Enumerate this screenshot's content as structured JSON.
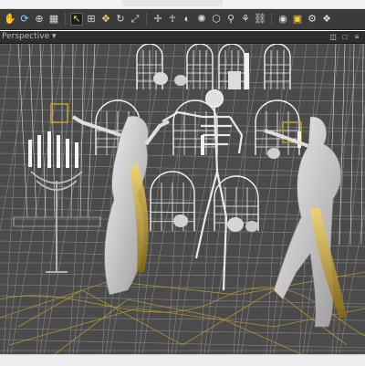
{
  "toolbar": {
    "tools": [
      {
        "icon": "hand-icon",
        "glyph": "✋",
        "color": "#d9d9d9"
      },
      {
        "icon": "rotate-view-icon",
        "glyph": "⟳",
        "color": "#8fd4ff"
      },
      {
        "icon": "zoom-icon",
        "glyph": "⊕",
        "color": "#d9d9d9"
      },
      {
        "icon": "grid-snap-icon",
        "glyph": "▦",
        "color": "#d9d9d9"
      },
      {
        "icon": "select-arrow-icon",
        "glyph": "↖",
        "color": "#ffc63a"
      },
      {
        "icon": "node-select-icon",
        "glyph": "⊞",
        "color": "#d9d9d9"
      },
      {
        "icon": "translate-icon",
        "glyph": "✥",
        "color": "#f0d060"
      },
      {
        "icon": "rotate-icon",
        "glyph": "↻",
        "color": "#d9d9d9"
      },
      {
        "icon": "scale-icon",
        "glyph": "⤢",
        "color": "#d9d9d9"
      },
      {
        "icon": "universal-icon",
        "glyph": "✛",
        "color": "#d9d9d9"
      },
      {
        "icon": "pose-icon",
        "glyph": "☥",
        "color": "#d9d9d9"
      },
      {
        "icon": "surface-icon",
        "glyph": "◐",
        "color": "#d9d9d9"
      },
      {
        "icon": "light-icon",
        "glyph": "✺",
        "color": "#d9d9d9"
      },
      {
        "icon": "geometry-icon",
        "glyph": "⬡",
        "color": "#d9d9d9"
      },
      {
        "icon": "joint-icon",
        "glyph": "⚲",
        "color": "#d9d9d9"
      },
      {
        "icon": "morph-icon",
        "glyph": "⚘",
        "color": "#d9d9d9"
      },
      {
        "icon": "link-icon",
        "glyph": "⛓",
        "color": "#d9d9d9"
      },
      {
        "icon": "camera-icon",
        "glyph": "◉",
        "color": "#d9d9d9"
      },
      {
        "icon": "render-icon",
        "glyph": "▣",
        "color": "#ffc63a"
      },
      {
        "icon": "render-settings-icon",
        "glyph": "⚙",
        "color": "#d9d9d9"
      },
      {
        "icon": "iray-icon",
        "glyph": "❖",
        "color": "#d9d9d9"
      }
    ]
  },
  "viewport": {
    "camera_label": "Perspective ▾",
    "right_icons": [
      {
        "icon": "camera-view-icon",
        "glyph": "◫"
      },
      {
        "icon": "maximize-icon",
        "glyph": "□"
      },
      {
        "icon": "menu-icon",
        "glyph": "≡"
      }
    ]
  }
}
